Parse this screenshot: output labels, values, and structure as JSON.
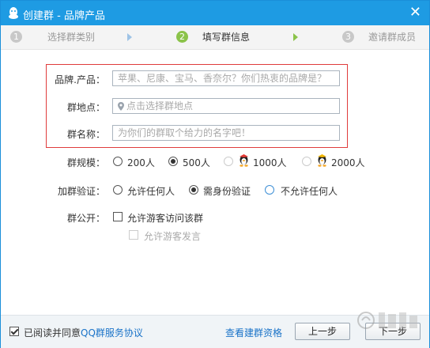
{
  "window": {
    "title": "创建群 - 品牌产品",
    "close_glyph": "✕"
  },
  "steps": [
    {
      "num": "1",
      "label": "选择群类别"
    },
    {
      "num": "2",
      "label": "填写群信息"
    },
    {
      "num": "3",
      "label": "邀请群成员"
    }
  ],
  "form": {
    "brand": {
      "label": "品牌.产品：",
      "placeholder": "苹果、尼康、宝马、香奈尔？你们热衷的品牌是？"
    },
    "location": {
      "label": "群地点：",
      "placeholder": "点击选择群地点"
    },
    "name": {
      "label": "群名称：",
      "placeholder": "为你们的群取个给力的名字吧！"
    },
    "scale": {
      "label": "群规模：",
      "options": [
        "200人",
        "500人",
        "1000人",
        "2000人"
      ],
      "selected": "500人"
    },
    "verify": {
      "label": "加群验证：",
      "options": [
        "允许任何人",
        "需身份验证",
        "不允许任何人"
      ],
      "selected": "需身份验证"
    },
    "public": {
      "label": "群公开：",
      "visitor_access": "允许游客访问该群",
      "visitor_speak": "允许游客发言"
    }
  },
  "footer": {
    "agree_prefix": "已阅读并同意",
    "agree_link": "QQ群服务协议",
    "qualification_link": "查看建群资格",
    "prev_button": "上一步",
    "next_button": "下一步"
  },
  "colors": {
    "titlebar": "#1e9be3",
    "accent_green": "#8bc34a",
    "link_blue": "#1a73c8",
    "highlight_red": "#e03c3c"
  }
}
